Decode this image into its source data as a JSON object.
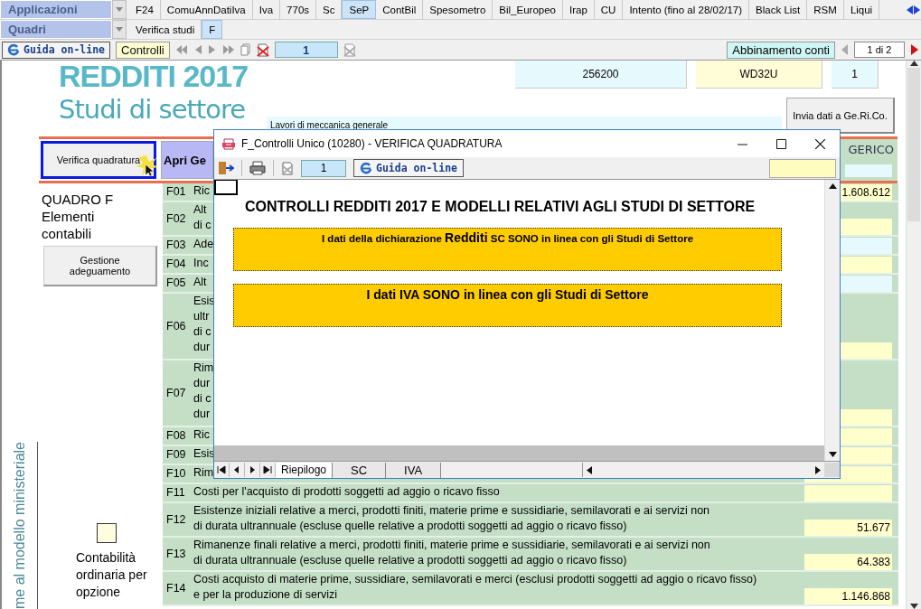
{
  "menu_rows": [
    {
      "selector": "Applicazioni",
      "tabs": [
        {
          "label": "F24",
          "selected": false
        },
        {
          "label": "ComuAnnDatiIva",
          "selected": false
        },
        {
          "label": "Iva",
          "selected": false
        },
        {
          "label": "770s",
          "selected": false
        },
        {
          "label": "Sc",
          "selected": false
        },
        {
          "label": "SeP",
          "selected": true
        },
        {
          "label": "ContBil",
          "selected": false
        },
        {
          "label": "Spesometro",
          "selected": false
        },
        {
          "label": "Bil_Europeo",
          "selected": false
        },
        {
          "label": "Irap",
          "selected": false
        },
        {
          "label": "CU",
          "selected": false
        },
        {
          "label": "Intento (fino al 28/02/17)",
          "selected": false
        },
        {
          "label": "Black List",
          "selected": false
        },
        {
          "label": "RSM",
          "selected": false
        },
        {
          "label": "Liqui",
          "selected": false
        }
      ]
    },
    {
      "selector": "Quadri",
      "tabs": [
        {
          "label": "Verifica studi",
          "selected": false
        },
        {
          "label": "F",
          "selected": true
        }
      ]
    }
  ],
  "toolbar": {
    "help_button": "Guida on-line",
    "controls_button": "Controlli",
    "record_field": "1",
    "link_button": "Abbinamento conti",
    "page_indicator": "1 di 2"
  },
  "form": {
    "title": "REDDITI 2017",
    "subtitle": "Studi di settore",
    "header_fields": [
      {
        "value": "256200",
        "color": "#e6fafd"
      },
      {
        "value": "WD32U",
        "color": "#fffdd8"
      },
      {
        "value": "1",
        "color": "#e6fafd"
      }
    ],
    "activity": "Lavori di meccanica generale",
    "send_button": "Invia dati a Ge.Ri.Co.",
    "verify_button": "Verifica quadratura",
    "open_button": "Apri Ge",
    "column_header": "GERICO",
    "section_title": "QUADRO F Elementi contabili",
    "adjust_button": "Gestione adeguamento",
    "option_checkbox": {
      "checked": false
    },
    "option_label": "Contabilità ordinaria per opzione",
    "side_caption": "me al modello ministeriale",
    "rows": [
      {
        "code": "F01",
        "lines": [
          "Ric"
        ],
        "value": "1.608.612",
        "color": "#ffffcc"
      },
      {
        "code": "F02",
        "lines": [
          "Alt",
          "di c"
        ],
        "color": "#ffffcc"
      },
      {
        "code": "F03",
        "lines": [
          "Ade"
        ],
        "color": "#e6fafd"
      },
      {
        "code": "F04",
        "lines": [
          "Inc"
        ],
        "color": "#ffffcc"
      },
      {
        "code": "F05",
        "lines": [
          "Alt"
        ],
        "color": "#e6fafd"
      },
      {
        "code": "F06",
        "lines": [
          "Esis",
          "ultr",
          "di c",
          "dur"
        ],
        "color": "#ffffcc"
      },
      {
        "code": "F07",
        "lines": [
          "Rim",
          "dur",
          "di c",
          "dur"
        ],
        "color": "#ffffcc"
      },
      {
        "code": "F08",
        "lines": [
          "Ric"
        ],
        "color": "#ffffcc"
      },
      {
        "code": "F09",
        "lines": [
          "Esis"
        ],
        "color": "#ffffcc"
      },
      {
        "code": "F10",
        "lines": [
          "Rim"
        ],
        "color": "#ffffcc"
      },
      {
        "code": "F11",
        "lines": [
          "Costi per l'acquisto di prodotti soggetti ad aggio o ricavo fisso"
        ],
        "color": "#ffffcc"
      },
      {
        "code": "F12",
        "lines": [
          "Esistenze iniziali relative a merci, prodotti finiti, materie prime e sussidiarie, semilavorati e ai servizi non",
          "di durata ultrannuale (escluse quelle relative a prodotti soggetti ad aggio o ricavo fisso)"
        ],
        "value": "51.677",
        "color": "#ffffcc"
      },
      {
        "code": "F13",
        "lines": [
          "Rimanenze finali relative a merci, prodotti finiti, materie prime e sussidiarie, semilavorati e ai servizi non",
          "di durata ultrannuale (escluse quelle relative a prodotti soggetti ad aggio o ricavo fisso)"
        ],
        "value": "64.383",
        "color": "#ffffcc"
      },
      {
        "code": "F14",
        "lines": [
          "Costi acquisto di materie prime, sussidiare, semilavorati e merci  (esclusi prodotti soggetti ad aggio o ricavo fisso)",
          "e per la produzione di servizi"
        ],
        "value": "1.146.868",
        "color": "#ffffcc"
      }
    ]
  },
  "dialog": {
    "title": "F_Controlli Unico (10280) - VERIFICA QUADRATURA",
    "record_field": "1",
    "help_button": "Guida on-line",
    "heading": "CONTROLLI REDDITI 2017 E MODELLI RELATIVI AGLI STUDI DI SETTORE",
    "result_boxes": [
      {
        "lead": "I dati della dichiarazione",
        "emphasis": "Redditi",
        "text": "SC SONO in linea con gli Studi di Settore"
      },
      {
        "text": "I dati IVA SONO in linea con gli Studi di Settore"
      }
    ],
    "sheet_tabs": [
      {
        "label": "Riepilogo",
        "selected": true
      },
      {
        "label": "SC",
        "selected": false
      },
      {
        "label": "IVA",
        "selected": false
      }
    ]
  }
}
